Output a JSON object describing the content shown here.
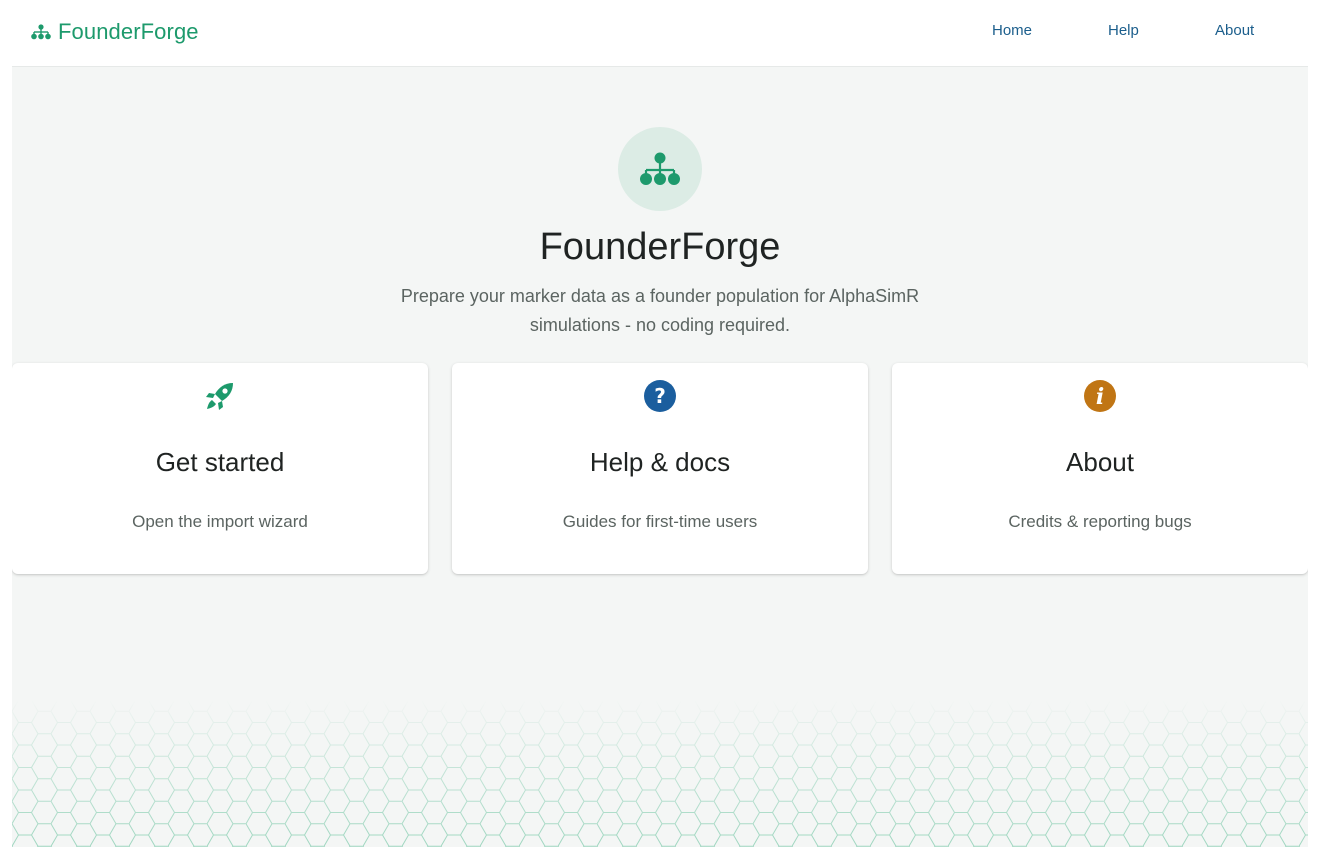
{
  "navbar": {
    "brand": "FounderForge",
    "links": [
      {
        "label": "Home"
      },
      {
        "label": "Help"
      },
      {
        "label": "About"
      }
    ]
  },
  "hero": {
    "icon": "hierarchy-icon",
    "title": "FounderForge",
    "subtitle": "Prepare your marker data as a founder population for AlphaSimR simulations - no coding required."
  },
  "cards": [
    {
      "icon": "rocket-icon",
      "icon_color": "#1d9a6c",
      "title": "Get started",
      "description": "Open the import wizard"
    },
    {
      "icon": "question-circle-icon",
      "icon_color": "#1b5e9e",
      "title": "Help & docs",
      "description": "Guides for first-time users"
    },
    {
      "icon": "info-circle-icon",
      "icon_color": "#c07514",
      "title": "About",
      "description": "Credits & reporting bugs"
    }
  ],
  "colors": {
    "brand": "#1d9a6c",
    "link": "#1b5e8c",
    "background": "#f4f6f5"
  }
}
